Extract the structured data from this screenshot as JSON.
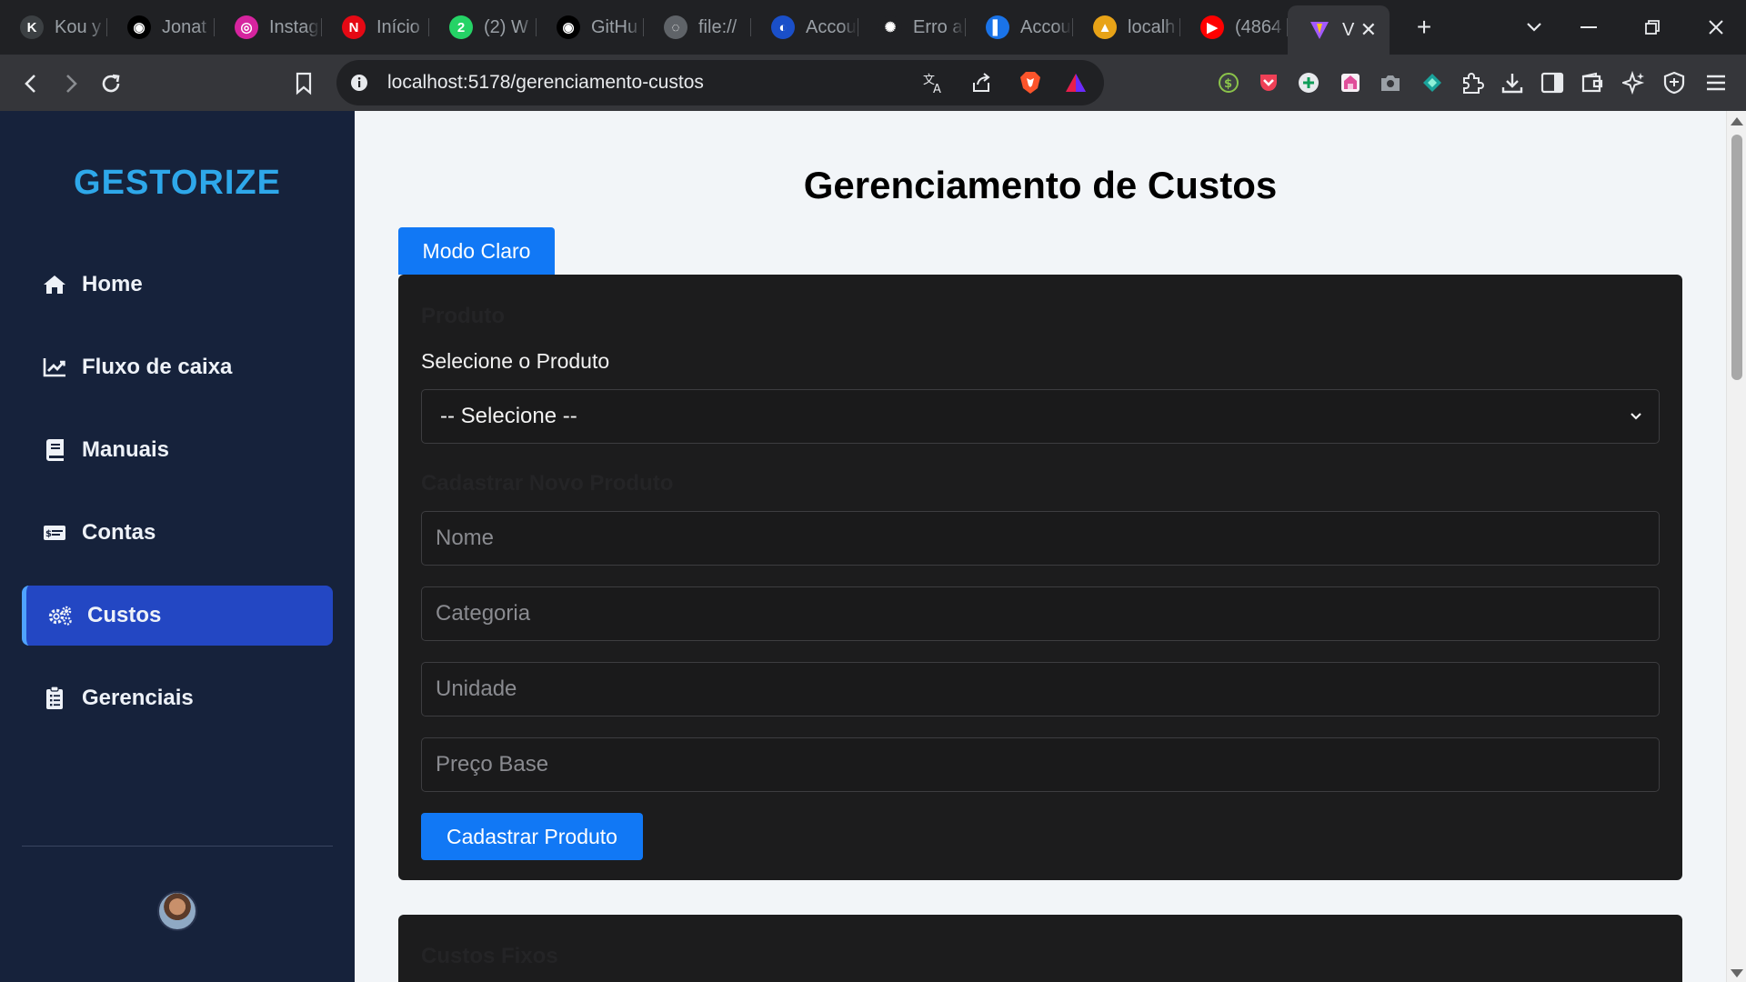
{
  "browser": {
    "tabs": [
      {
        "label": "Kou y",
        "icon": "kou-favicon",
        "color": "#3c4043"
      },
      {
        "label": "Jonat",
        "icon": "github-favicon",
        "color": "#000000"
      },
      {
        "label": "Instag",
        "icon": "instagram-favicon",
        "color": "#d6249f"
      },
      {
        "label": "Início",
        "icon": "netflix-favicon",
        "color": "#e50914"
      },
      {
        "label": "(2) W",
        "icon": "whatsapp-favicon",
        "color": "#25d366"
      },
      {
        "label": "GitHu",
        "icon": "github-favicon",
        "color": "#000000"
      },
      {
        "label": "file://",
        "icon": "globe-favicon",
        "color": "#5f6368"
      },
      {
        "label": "Accou",
        "icon": "account-favicon",
        "color": "#1a4fc9"
      },
      {
        "label": "Erro a",
        "icon": "openai-favicon",
        "color": "#202124"
      },
      {
        "label": "Accou",
        "icon": "account-square-favicon",
        "color": "#1a73e8"
      },
      {
        "label": "localh",
        "icon": "mountain-favicon",
        "color": "#e8a317"
      },
      {
        "label": "(4864",
        "icon": "youtube-favicon",
        "color": "#ff0000"
      }
    ],
    "active_tab": {
      "label": "V",
      "icon": "vite-favicon",
      "close": "✕"
    },
    "new_tab": "+",
    "url": "localhost:5178/gerenciamento-custos"
  },
  "sidebar": {
    "brand": "GESTORIZE",
    "items": [
      {
        "label": "Home",
        "icon": "home-icon"
      },
      {
        "label": "Fluxo de caixa",
        "icon": "chart-line-icon"
      },
      {
        "label": "Manuais",
        "icon": "book-icon"
      },
      {
        "label": "Contas",
        "icon": "money-card-icon"
      },
      {
        "label": "Custos",
        "icon": "cogs-icon",
        "active": true
      },
      {
        "label": "Gerenciais",
        "icon": "clipboard-icon"
      }
    ]
  },
  "main": {
    "title": "Gerenciamento de Custos",
    "mode_button": "Modo Claro",
    "product_section": {
      "title": "Produto",
      "select_label": "Selecione o Produto",
      "select_value": "-- Selecione --",
      "new_product_title": "Cadastrar Novo Produto",
      "placeholders": {
        "name": "Nome",
        "category": "Categoria",
        "unit": "Unidade",
        "base_price": "Preço Base"
      },
      "submit": "Cadastrar Produto"
    },
    "fixed_costs_title": "Custos Fixos"
  },
  "colors": {
    "brand": "#2ea8ea",
    "sidebar_bg": "#16223b",
    "active_nav": "#2347c3",
    "primary_button": "#1178f5",
    "card_bg": "#1c1c1d"
  }
}
